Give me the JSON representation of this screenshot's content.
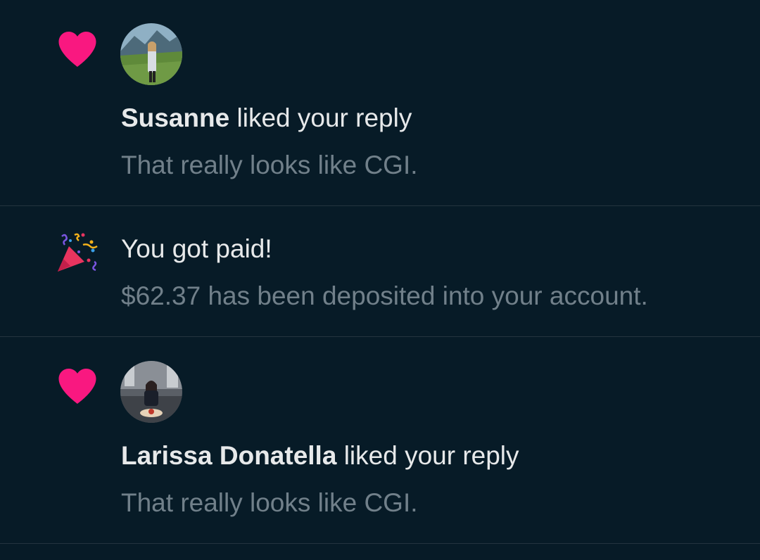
{
  "colors": {
    "background": "#071b27",
    "heart": "#f91880",
    "primary_text": "#e7e9ea",
    "secondary_text": "#71808a",
    "divider": "#24343f"
  },
  "notifications": [
    {
      "type": "like",
      "icon": "heart-icon",
      "user_name": "Susanne",
      "action_text": "liked your reply",
      "content": "That really looks like CGI."
    },
    {
      "type": "payment",
      "icon": "party-popper-icon",
      "title": "You got paid!",
      "content": "$62.37 has been deposited into your account."
    },
    {
      "type": "like",
      "icon": "heart-icon",
      "user_name": "Larissa Donatella",
      "action_text": "liked your reply",
      "content": "That really looks like CGI."
    }
  ]
}
